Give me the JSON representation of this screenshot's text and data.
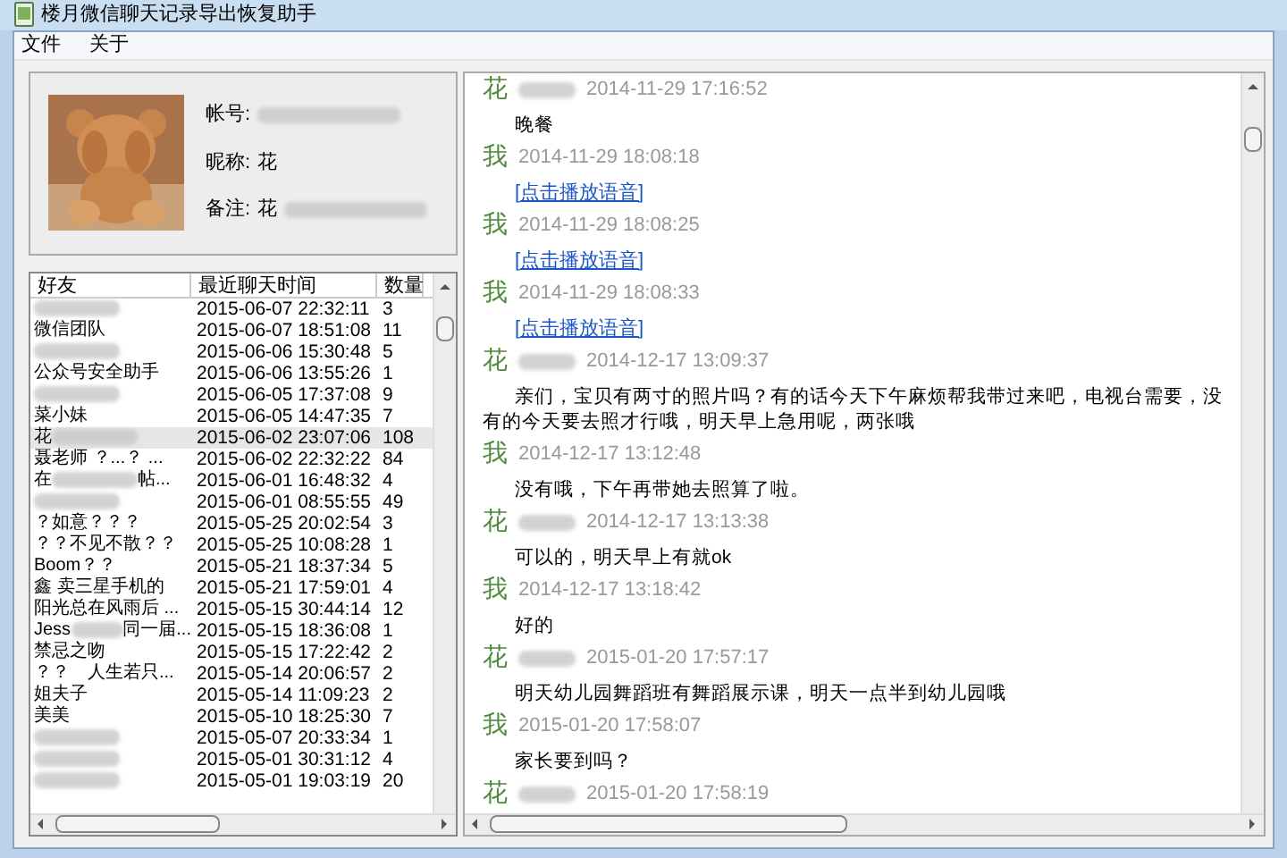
{
  "window": {
    "title": "楼月微信聊天记录导出恢复助手"
  },
  "menu": [
    "文件",
    "关于"
  ],
  "profile": {
    "fields": [
      {
        "label": "帐号:",
        "parts": [
          {
            "kind": "blur"
          }
        ]
      },
      {
        "label": "昵称:",
        "parts": [
          {
            "kind": "text",
            "text": "花"
          }
        ]
      },
      {
        "label": "备注:",
        "parts": [
          {
            "kind": "text",
            "text": "花"
          },
          {
            "kind": "blur"
          }
        ]
      }
    ]
  },
  "table": {
    "columns": [
      "好友",
      "最近聊天时间",
      "数量"
    ],
    "rows": [
      {
        "name": [
          {
            "kind": "blur"
          }
        ],
        "time": "2015-06-07 22:32:11",
        "count": "3",
        "selected": false
      },
      {
        "name": [
          {
            "kind": "text",
            "text": "微信团队"
          }
        ],
        "time": "2015-06-07 18:51:08",
        "count": "11",
        "selected": false
      },
      {
        "name": [
          {
            "kind": "blur"
          }
        ],
        "time": "2015-06-06 15:30:48",
        "count": "5",
        "selected": false
      },
      {
        "name": [
          {
            "kind": "text",
            "text": "公众号安全助手"
          }
        ],
        "time": "2015-06-06 13:55:26",
        "count": "1",
        "selected": false
      },
      {
        "name": [
          {
            "kind": "blur"
          }
        ],
        "time": "2015-06-05 17:37:08",
        "count": "9",
        "selected": false
      },
      {
        "name": [
          {
            "kind": "text",
            "text": "菜小妹"
          }
        ],
        "time": "2015-06-05 14:47:35",
        "count": "7",
        "selected": false
      },
      {
        "name": [
          {
            "kind": "text",
            "text": "花"
          },
          {
            "kind": "blur"
          }
        ],
        "time": "2015-06-02 23:07:06",
        "count": "108",
        "selected": true
      },
      {
        "name": [
          {
            "kind": "text",
            "text": "聂老师 ？...？ ..."
          }
        ],
        "time": "2015-06-02 22:32:22",
        "count": "84",
        "selected": false
      },
      {
        "name": [
          {
            "kind": "text",
            "text": "在"
          },
          {
            "kind": "blur"
          },
          {
            "kind": "text",
            "text": "帖..."
          }
        ],
        "time": "2015-06-01 16:48:32",
        "count": "4",
        "selected": false
      },
      {
        "name": [
          {
            "kind": "blur"
          }
        ],
        "time": "2015-06-01 08:55:55",
        "count": "49",
        "selected": false
      },
      {
        "name": [
          {
            "kind": "text",
            "text": "？如意？？？"
          }
        ],
        "time": "2015-05-25 20:02:54",
        "count": "3",
        "selected": false
      },
      {
        "name": [
          {
            "kind": "text",
            "text": "？？不见不散？？"
          }
        ],
        "time": "2015-05-25 10:08:28",
        "count": "1",
        "selected": false
      },
      {
        "name": [
          {
            "kind": "text",
            "text": "Boom？？"
          }
        ],
        "time": "2015-05-21 18:37:34",
        "count": "5",
        "selected": false
      },
      {
        "name": [
          {
            "kind": "text",
            "text": "鑫 卖三星手机的"
          }
        ],
        "time": "2015-05-21 17:59:01",
        "count": "4",
        "selected": false
      },
      {
        "name": [
          {
            "kind": "text",
            "text": "阳光总在风雨后 ..."
          }
        ],
        "time": "2015-05-15 30:44:14",
        "count": "12",
        "selected": false
      },
      {
        "name": [
          {
            "kind": "text",
            "text": "Jess"
          },
          {
            "kind": "blur"
          },
          {
            "kind": "text",
            "text": "同一届..."
          }
        ],
        "time": "2015-05-15 18:36:08",
        "count": "1",
        "selected": false
      },
      {
        "name": [
          {
            "kind": "text",
            "text": "禁忌之吻"
          }
        ],
        "time": "2015-05-15 17:22:42",
        "count": "2",
        "selected": false
      },
      {
        "name": [
          {
            "kind": "text",
            "text": "？？　人生若只..."
          }
        ],
        "time": "2015-05-14 20:06:57",
        "count": "2",
        "selected": false
      },
      {
        "name": [
          {
            "kind": "text",
            "text": "姐夫子"
          }
        ],
        "time": "2015-05-14 11:09:23",
        "count": "2",
        "selected": false
      },
      {
        "name": [
          {
            "kind": "text",
            "text": "美美"
          }
        ],
        "time": "2015-05-10 18:25:30",
        "count": "7",
        "selected": false
      },
      {
        "name": [
          {
            "kind": "blur"
          }
        ],
        "time": "2015-05-07 20:33:34",
        "count": "1",
        "selected": false
      },
      {
        "name": [
          {
            "kind": "blur"
          }
        ],
        "time": "2015-05-01 30:31:12",
        "count": "4",
        "selected": false
      },
      {
        "name": [
          {
            "kind": "blur"
          }
        ],
        "time": "2015-05-01 19:03:19",
        "count": "20",
        "selected": false
      }
    ]
  },
  "chat": [
    {
      "sender": "花",
      "redacted": true,
      "time": "2014-11-29 17:16:52",
      "kind": "text",
      "content": "晚餐"
    },
    {
      "sender": "我",
      "redacted": false,
      "time": "2014-11-29 18:08:18",
      "kind": "link",
      "content": "[点击播放语音]"
    },
    {
      "sender": "我",
      "redacted": false,
      "time": "2014-11-29 18:08:25",
      "kind": "link",
      "content": "[点击播放语音]"
    },
    {
      "sender": "我",
      "redacted": false,
      "time": "2014-11-29 18:08:33",
      "kind": "link",
      "content": "[点击播放语音]"
    },
    {
      "sender": "花",
      "redacted": true,
      "time": "2014-12-17 13:09:37",
      "kind": "text",
      "content": "亲们，宝贝有两寸的照片吗？有的话今天下午麻烦帮我带过来吧，电视台需要，没有的今天要去照才行哦，明天早上急用呢，两张哦"
    },
    {
      "sender": "我",
      "redacted": false,
      "time": "2014-12-17 13:12:48",
      "kind": "text",
      "content": "没有哦，下午再带她去照算了啦。"
    },
    {
      "sender": "花",
      "redacted": true,
      "time": "2014-12-17 13:13:38",
      "kind": "text",
      "content": "可以的，明天早上有就ok"
    },
    {
      "sender": "我",
      "redacted": false,
      "time": "2014-12-17 13:18:42",
      "kind": "text",
      "content": "好的"
    },
    {
      "sender": "花",
      "redacted": true,
      "time": "2015-01-20 17:57:17",
      "kind": "text",
      "content": "明天幼儿园舞蹈班有舞蹈展示课，明天一点半到幼儿园哦"
    },
    {
      "sender": "我",
      "redacted": false,
      "time": "2015-01-20 17:58:07",
      "kind": "text",
      "content": "家长要到吗？"
    },
    {
      "sender": "花",
      "redacted": true,
      "time": "2015-01-20 17:58:19"
    }
  ]
}
